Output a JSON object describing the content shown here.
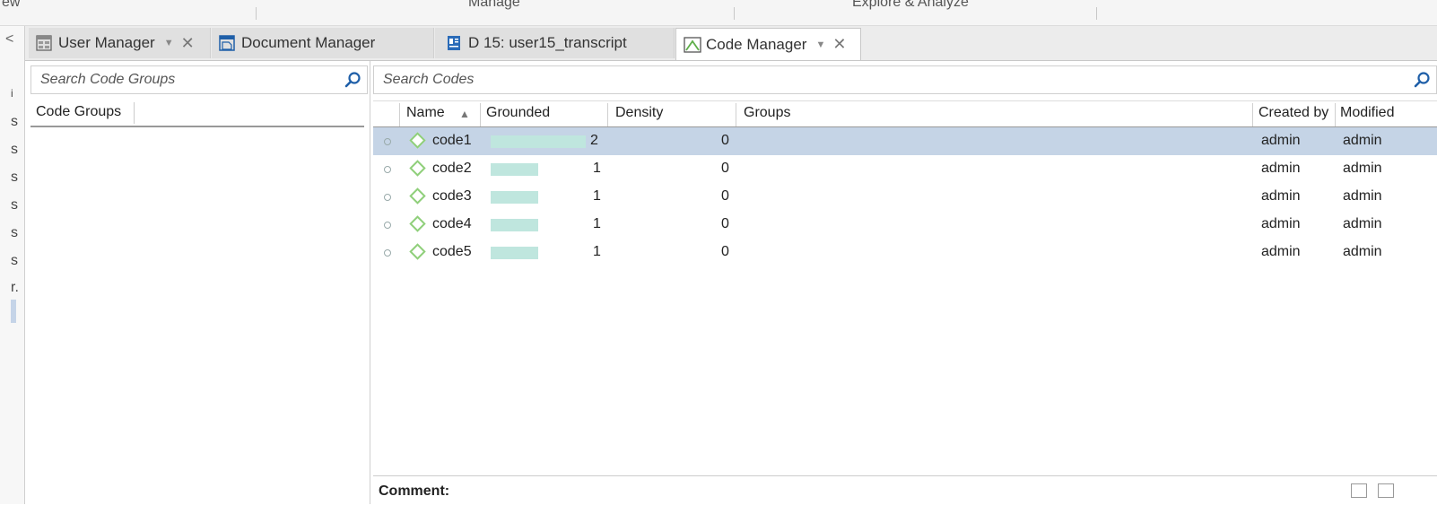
{
  "ribbon": {
    "left_fragment": "ew",
    "manage": "Manage",
    "explore": "Explore & Analyze"
  },
  "left_strip": {
    "chevron": "<",
    "items": [
      "i",
      "s",
      "s",
      "s",
      "s",
      "s",
      "s",
      "r."
    ]
  },
  "tabs": [
    {
      "label": "User Manager",
      "icon": "user-manager-icon",
      "dropdown": "▼",
      "close": "✕",
      "active": false
    },
    {
      "label": "Document Manager",
      "icon": "document-manager-icon",
      "active": false
    },
    {
      "label": "D 15: user15_transcript",
      "icon": "document-icon",
      "active": false
    },
    {
      "label": "Code Manager",
      "icon": "code-manager-icon",
      "dropdown": "▼",
      "close": "✕",
      "active": true
    }
  ],
  "code_groups": {
    "search_placeholder": "Search Code Groups",
    "column_header": "Code Groups"
  },
  "codes": {
    "search_placeholder": "Search Codes",
    "columns": {
      "name": "Name",
      "sort_indicator": "▲",
      "grounded": "Grounded",
      "density": "Density",
      "groups": "Groups",
      "created_by": "Created by",
      "modified": "Modified"
    },
    "rows": [
      {
        "name": "code1",
        "grounded": "2",
        "grounded_fraction": 1.0,
        "density": "0",
        "groups": "",
        "created_by": "admin",
        "modified_by": "admin",
        "selected": true
      },
      {
        "name": "code2",
        "grounded": "1",
        "grounded_fraction": 0.5,
        "density": "0",
        "groups": "",
        "created_by": "admin",
        "modified_by": "admin",
        "selected": false
      },
      {
        "name": "code3",
        "grounded": "1",
        "grounded_fraction": 0.5,
        "density": "0",
        "groups": "",
        "created_by": "admin",
        "modified_by": "admin",
        "selected": false
      },
      {
        "name": "code4",
        "grounded": "1",
        "grounded_fraction": 0.5,
        "density": "0",
        "groups": "",
        "created_by": "admin",
        "modified_by": "admin",
        "selected": false
      },
      {
        "name": "code5",
        "grounded": "1",
        "grounded_fraction": 0.5,
        "density": "0",
        "groups": "",
        "created_by": "admin",
        "modified_by": "admin",
        "selected": false
      }
    ],
    "comment_label": "Comment:"
  },
  "colors": {
    "selected_row": "#c5d4e6",
    "grounded_bar": "#bfe6de",
    "code_icon": "#8fcf7a",
    "search_icon": "#1f5fa8"
  }
}
